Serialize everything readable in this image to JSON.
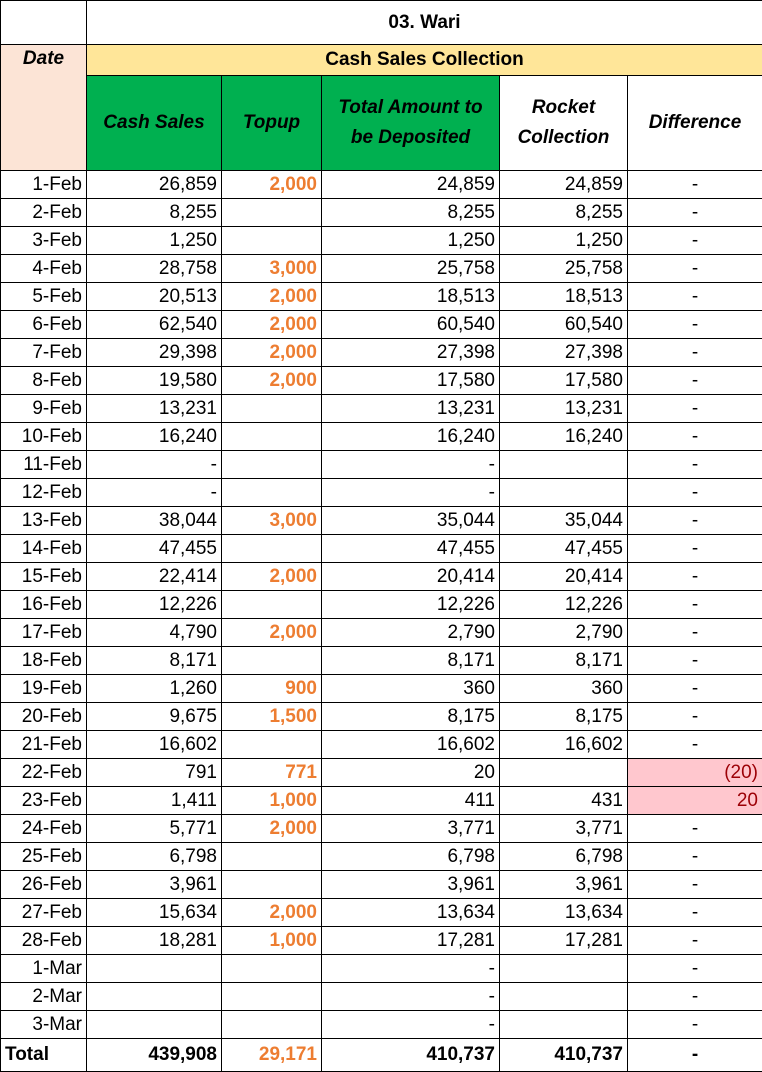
{
  "title": "03. Wari",
  "group_header": "Cash Sales Collection",
  "headers": {
    "date": "Date",
    "cash_sales": "Cash Sales",
    "topup": "Topup",
    "total_deposited": "Total Amount to be Deposited",
    "rocket": "Rocket Collection",
    "difference": "Difference"
  },
  "colors": {
    "topup": "#ED7D31",
    "green_header": "#00B050",
    "date_header": "#FCE4D6",
    "group_header": "#FFE699",
    "negative_bg": "#FFC7CE",
    "negative_text": "#9C0006"
  },
  "rows": [
    {
      "date": "1-Feb",
      "cash": "26,859",
      "topup": "2,000",
      "total": "24,859",
      "rocket": "24,859",
      "diff": "-"
    },
    {
      "date": "2-Feb",
      "cash": "8,255",
      "topup": "",
      "total": "8,255",
      "rocket": "8,255",
      "diff": "-"
    },
    {
      "date": "3-Feb",
      "cash": "1,250",
      "topup": "",
      "total": "1,250",
      "rocket": "1,250",
      "diff": "-"
    },
    {
      "date": "4-Feb",
      "cash": "28,758",
      "topup": "3,000",
      "total": "25,758",
      "rocket": "25,758",
      "diff": "-"
    },
    {
      "date": "5-Feb",
      "cash": "20,513",
      "topup": "2,000",
      "total": "18,513",
      "rocket": "18,513",
      "diff": "-"
    },
    {
      "date": "6-Feb",
      "cash": "62,540",
      "topup": "2,000",
      "total": "60,540",
      "rocket": "60,540",
      "diff": "-"
    },
    {
      "date": "7-Feb",
      "cash": "29,398",
      "topup": "2,000",
      "total": "27,398",
      "rocket": "27,398",
      "diff": "-"
    },
    {
      "date": "8-Feb",
      "cash": "19,580",
      "topup": "2,000",
      "total": "17,580",
      "rocket": "17,580",
      "diff": "-"
    },
    {
      "date": "9-Feb",
      "cash": "13,231",
      "topup": "",
      "total": "13,231",
      "rocket": "13,231",
      "diff": "-"
    },
    {
      "date": "10-Feb",
      "cash": "16,240",
      "topup": "",
      "total": "16,240",
      "rocket": "16,240",
      "diff": "-"
    },
    {
      "date": "11-Feb",
      "cash": "-",
      "topup": "",
      "total": "-",
      "rocket": "",
      "diff": "-"
    },
    {
      "date": "12-Feb",
      "cash": "-",
      "topup": "",
      "total": "-",
      "rocket": "",
      "diff": "-"
    },
    {
      "date": "13-Feb",
      "cash": "38,044",
      "topup": "3,000",
      "total": "35,044",
      "rocket": "35,044",
      "diff": "-"
    },
    {
      "date": "14-Feb",
      "cash": "47,455",
      "topup": "",
      "total": "47,455",
      "rocket": "47,455",
      "diff": "-"
    },
    {
      "date": "15-Feb",
      "cash": "22,414",
      "topup": "2,000",
      "total": "20,414",
      "rocket": "20,414",
      "diff": "-"
    },
    {
      "date": "16-Feb",
      "cash": "12,226",
      "topup": "",
      "total": "12,226",
      "rocket": "12,226",
      "diff": "-"
    },
    {
      "date": "17-Feb",
      "cash": "4,790",
      "topup": "2,000",
      "total": "2,790",
      "rocket": "2,790",
      "diff": "-"
    },
    {
      "date": "18-Feb",
      "cash": "8,171",
      "topup": "",
      "total": "8,171",
      "rocket": "8,171",
      "diff": "-"
    },
    {
      "date": "19-Feb",
      "cash": "1,260",
      "topup": "900",
      "total": "360",
      "rocket": "360",
      "diff": "-"
    },
    {
      "date": "20-Feb",
      "cash": "9,675",
      "topup": "1,500",
      "total": "8,175",
      "rocket": "8,175",
      "diff": "-"
    },
    {
      "date": "21-Feb",
      "cash": "16,602",
      "topup": "",
      "total": "16,602",
      "rocket": "16,602",
      "diff": "-"
    },
    {
      "date": "22-Feb",
      "cash": "791",
      "topup": "771",
      "total": "20",
      "rocket": "",
      "diff": "(20)",
      "highlight": true
    },
    {
      "date": "23-Feb",
      "cash": "1,411",
      "topup": "1,000",
      "total": "411",
      "rocket": "431",
      "diff": "20",
      "highlight": true
    },
    {
      "date": "24-Feb",
      "cash": "5,771",
      "topup": "2,000",
      "total": "3,771",
      "rocket": "3,771",
      "diff": "-"
    },
    {
      "date": "25-Feb",
      "cash": "6,798",
      "topup": "",
      "total": "6,798",
      "rocket": "6,798",
      "diff": "-"
    },
    {
      "date": "26-Feb",
      "cash": "3,961",
      "topup": "",
      "total": "3,961",
      "rocket": "3,961",
      "diff": "-"
    },
    {
      "date": "27-Feb",
      "cash": "15,634",
      "topup": "2,000",
      "total": "13,634",
      "rocket": "13,634",
      "diff": "-"
    },
    {
      "date": "28-Feb",
      "cash": "18,281",
      "topup": "1,000",
      "total": "17,281",
      "rocket": "17,281",
      "diff": "-"
    },
    {
      "date": "1-Mar",
      "cash": "",
      "topup": "",
      "total": "-",
      "rocket": "",
      "diff": "-"
    },
    {
      "date": "2-Mar",
      "cash": "",
      "topup": "",
      "total": "-",
      "rocket": "",
      "diff": "-"
    },
    {
      "date": "3-Mar",
      "cash": "",
      "topup": "",
      "total": "-",
      "rocket": "",
      "diff": "-"
    }
  ],
  "total": {
    "label": "Total",
    "cash": "439,908",
    "topup": "29,171",
    "total": "410,737",
    "rocket": "410,737",
    "diff": "-"
  }
}
